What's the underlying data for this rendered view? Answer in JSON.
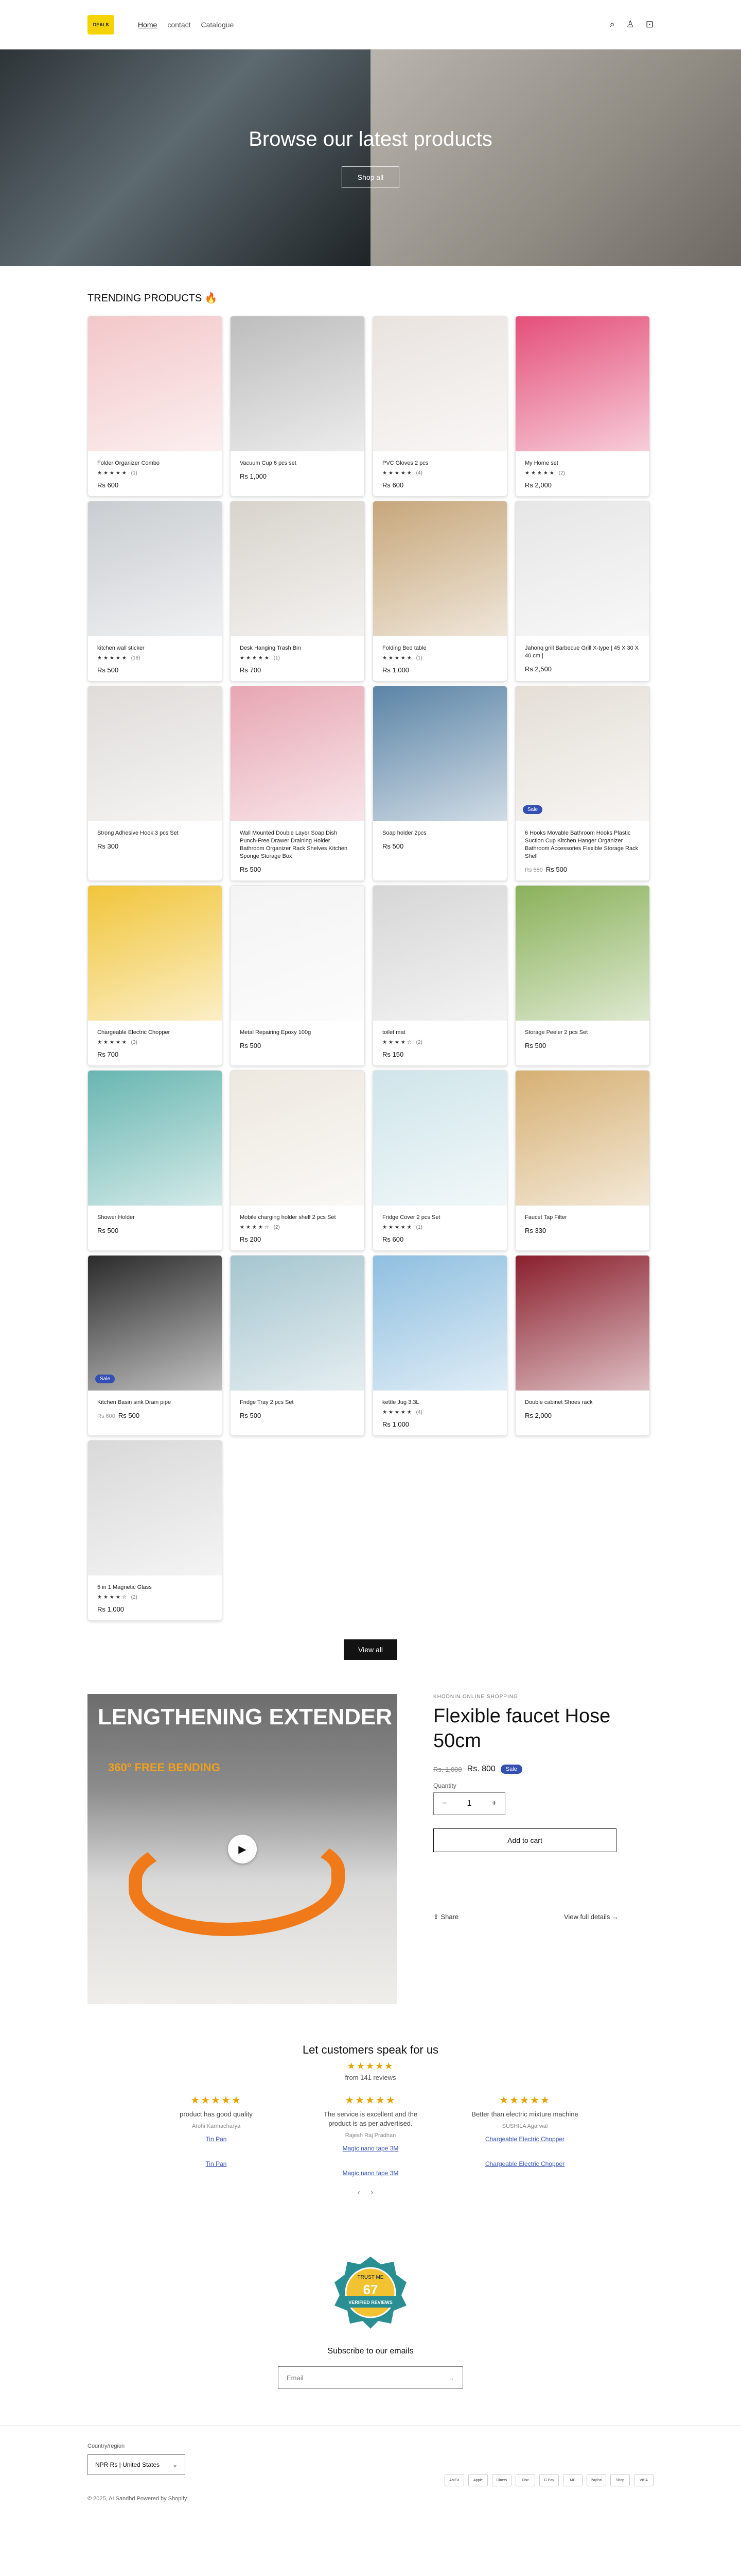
{
  "header": {
    "logo_text": "DEALS",
    "nav": [
      "Home",
      "contact",
      "Catalogue"
    ],
    "icons": [
      "search-icon",
      "account-icon",
      "cart-icon"
    ]
  },
  "hero": {
    "title": "Browse our latest products",
    "button": "Shop all"
  },
  "trending": {
    "heading": "TRENDING PRODUCTS 🔥",
    "products": [
      {
        "title": "Folder Organizer Combo",
        "rating": "★★★★★",
        "reviews": "(1)",
        "price": "Rs 600",
        "compare": "",
        "badge": "",
        "color": "#f3c7c9"
      },
      {
        "title": "Vacuum Cup 6 pcs set",
        "rating": "",
        "reviews": "",
        "price": "Rs 1,000",
        "compare": "",
        "badge": "",
        "color": "#bdbdbd"
      },
      {
        "title": "PVC Gloves 2 pcs",
        "rating": "★★★★★",
        "reviews": "(4)",
        "price": "Rs 600",
        "compare": "",
        "badge": "",
        "color": "#e9e3df"
      },
      {
        "title": "My Home set",
        "rating": "★★★★★",
        "reviews": "(2)",
        "price": "Rs 2,000",
        "compare": "",
        "badge": "",
        "color": "#e44f7a"
      },
      {
        "title": "kitchen wall sticker",
        "rating": "★★★★★",
        "reviews": "(18)",
        "price": "Rs 500",
        "compare": "",
        "badge": "",
        "color": "#c9cdd1"
      },
      {
        "title": "Desk Hanging Trash Bin",
        "rating": "★★★★★",
        "reviews": "(1)",
        "price": "Rs 700",
        "compare": "",
        "badge": "",
        "color": "#d8d3cc"
      },
      {
        "title": "Folding Bed table",
        "rating": "★★★★★",
        "reviews": "(1)",
        "price": "Rs 1,000",
        "compare": "",
        "badge": "",
        "color": "#c7a77b"
      },
      {
        "title": "Jahonq grill Barbecue Grill X-type | 45 X 30 X 40 cm |",
        "rating": "",
        "reviews": "",
        "price": "Rs 2,500",
        "compare": "",
        "badge": "",
        "color": "#e6e6e6"
      },
      {
        "title": "Strong Adhesive Hook 3 pcs Set",
        "rating": "",
        "reviews": "",
        "price": "Rs 300",
        "compare": "",
        "badge": "",
        "color": "#dfdcd9"
      },
      {
        "title": "Wall Mounted Double Layer Soap Dish Punch-Free Drawer Draining Holder Bathroom Organizer Rack Shelves Kitchen Sponge Storage Box",
        "rating": "",
        "reviews": "",
        "price": "Rs 500",
        "compare": "",
        "badge": "",
        "color": "#e7a6b3"
      },
      {
        "title": "Soap holder 2pcs",
        "rating": "",
        "reviews": "",
        "price": "Rs 500",
        "compare": "",
        "badge": "",
        "color": "#5b84a6"
      },
      {
        "title": "6 Hooks Movable Bathroom Hooks Plastic Suction Cup Kitchen Hanger Organizer Bathroom Accessories Flexible Storage Rack Shelf",
        "rating": "",
        "reviews": "",
        "price": "Rs 500",
        "compare": "Rs 550",
        "badge": "Sale",
        "color": "#e4ded6"
      },
      {
        "title": "Chargeable Electric Chopper",
        "rating": "★★★★★",
        "reviews": "(3)",
        "price": "Rs 700",
        "compare": "",
        "badge": "",
        "color": "#f1c53a"
      },
      {
        "title": "Metal Repairing Epoxy 100g",
        "rating": "",
        "reviews": "",
        "price": "Rs 500",
        "compare": "",
        "badge": "",
        "color": "#f4f4f4"
      },
      {
        "title": "toilet mat",
        "rating": "★★★★☆",
        "reviews": "(2)",
        "price": "Rs 150",
        "compare": "",
        "badge": "",
        "color": "#d6d6d6"
      },
      {
        "title": "Storage Peeler 2 pcs Set",
        "rating": "",
        "reviews": "",
        "price": "Rs 500",
        "compare": "",
        "badge": "",
        "color": "#8ab15a"
      },
      {
        "title": "Shower Holder",
        "rating": "",
        "reviews": "",
        "price": "Rs 500",
        "compare": "",
        "badge": "",
        "color": "#68b6b1"
      },
      {
        "title": "Mobile charging holder shelf 2 pcs Set",
        "rating": "★★★★☆",
        "reviews": "(2)",
        "price": "Rs 200",
        "compare": "",
        "badge": "",
        "color": "#ede8df"
      },
      {
        "title": "Fridge Cover 2 pcs Set",
        "rating": "★★★★★",
        "reviews": "(1)",
        "price": "Rs 600",
        "compare": "",
        "badge": "",
        "color": "#cfe5ea"
      },
      {
        "title": "Faucet Tap Filter",
        "rating": "",
        "reviews": "",
        "price": "Rs 330",
        "compare": "",
        "badge": "",
        "color": "#d6b073"
      },
      {
        "title": "Kitchen Basin sink Drain pipe",
        "rating": "",
        "reviews": "",
        "price": "Rs 500",
        "compare": "Rs 600",
        "badge": "Sale",
        "color": "#2a2a2a"
      },
      {
        "title": "Fridge Tray 2 pcs Set",
        "rating": "",
        "reviews": "",
        "price": "Rs 500",
        "compare": "",
        "badge": "",
        "color": "#a5c5cf"
      },
      {
        "title": "kettle Jug 3.3L",
        "rating": "★★★★★",
        "reviews": "(4)",
        "price": "Rs 1,000",
        "compare": "",
        "badge": "",
        "color": "#8fbfe0"
      },
      {
        "title": "Double cabinet Shoes rack",
        "rating": "",
        "reviews": "",
        "price": "Rs 2,000",
        "compare": "",
        "badge": "",
        "color": "#8a1f2d"
      },
      {
        "title": "5 in 1 Magnetic Glass",
        "rating": "★★★★☆",
        "reviews": "(2)",
        "price": "Rs 1,000",
        "compare": "",
        "badge": "",
        "color": "#d9d9d9"
      }
    ],
    "view_all": "View all"
  },
  "featured": {
    "vendor": "KHODNIN ONLINE SHOPPING",
    "title": "Flexible faucet Hose 50cm",
    "compare": "Rs. 1,000",
    "price": "Rs. 800",
    "sale": "Sale",
    "qty_label": "Quantity",
    "qty": "1",
    "add_to_cart": "Add to cart",
    "share": "Share",
    "view_full": "View full details",
    "media_text": "LENGTHENING EXTENDER",
    "media_sub": "360° FREE BENDING"
  },
  "reviews": {
    "heading": "Let customers speak for us",
    "stars": "★★★★★",
    "count": "from 141 reviews",
    "items": [
      {
        "stars": "★★★★★",
        "text": "product has good quality",
        "author": "Arohi Karmacharya",
        "product": "Tin Pan",
        "product2": "Tin Pan"
      },
      {
        "stars": "★★★★★",
        "text": "The service is excellent and the product is as per advertised.",
        "author": "Rajesh Raj Pradhan",
        "product": "Magic nano tape 3M",
        "product2": "Magic nano tape 3M"
      },
      {
        "stars": "★★★★★",
        "text": "Better than electric mixture machine",
        "author": "SUSHILA Agarwal",
        "product": "Chargeable Electric Chopper",
        "product2": "Chargeable Electric Chopper"
      }
    ]
  },
  "seal": {
    "top": "TRUST ME",
    "num": "67",
    "bottom": "VERIFIED REVIEWS"
  },
  "newsletter": {
    "heading": "Subscribe to our emails",
    "placeholder": "Email"
  },
  "footer": {
    "country_label": "Country/region",
    "country": "NPR Rs | United States",
    "payments": [
      "AMEX",
      "Apple",
      "Diners",
      "Disc",
      "G Pay",
      "MC",
      "PayPal",
      "Shop",
      "VISA"
    ],
    "copyright": "© 2025, ALSandhd Powered by Shopify"
  }
}
